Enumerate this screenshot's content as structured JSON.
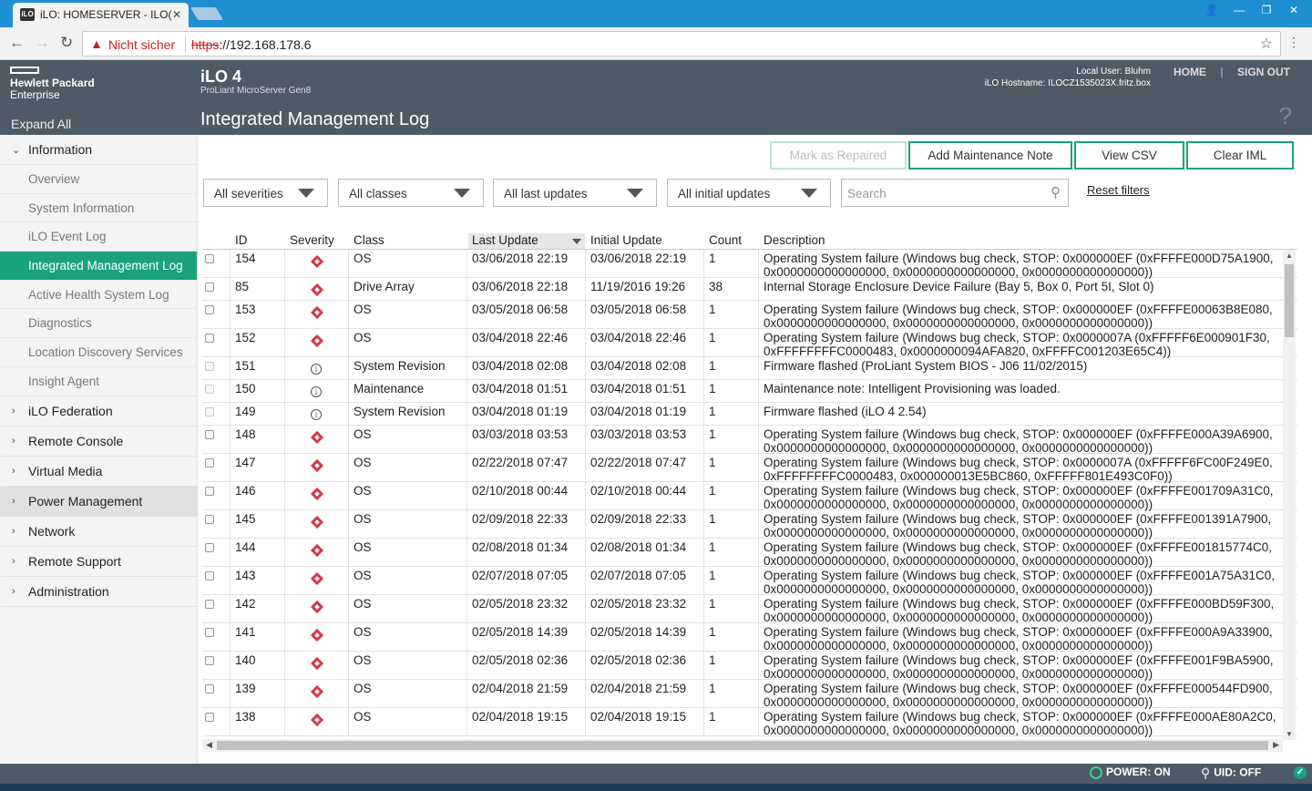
{
  "browser": {
    "tab_title": "iLO: HOMESERVER - ILO(",
    "tab_favicon": "iLO",
    "security_label": "Nicht sicher",
    "url_scheme": "https",
    "url_rest": "://192.168.178.6"
  },
  "header": {
    "brand_line1": "Hewlett Packard",
    "brand_line2": "Enterprise",
    "product": "iLO 4",
    "server_model": "ProLiant MicroServer Gen8",
    "page_title": "Integrated Management Log",
    "local_user": "Local User: Bluhm",
    "hostname": "iLO Hostname: ILOCZ1535023X.fritz.box",
    "home_link": "HOME",
    "sign_out_link": "SIGN OUT",
    "help_glyph": "?"
  },
  "sidebar": {
    "expand_all": "Expand All",
    "information_label": "Information",
    "info_items": [
      {
        "label": "Overview"
      },
      {
        "label": "System Information"
      },
      {
        "label": "iLO Event Log"
      },
      {
        "label": "Integrated Management Log"
      },
      {
        "label": "Active Health System Log"
      },
      {
        "label": "Diagnostics"
      },
      {
        "label": "Location Discovery Services"
      },
      {
        "label": "Insight Agent"
      }
    ],
    "sections": [
      {
        "label": "iLO Federation"
      },
      {
        "label": "Remote Console"
      },
      {
        "label": "Virtual Media"
      },
      {
        "label": "Power Management"
      },
      {
        "label": "Network"
      },
      {
        "label": "Remote Support"
      },
      {
        "label": "Administration"
      }
    ]
  },
  "actions": {
    "mark_repaired": "Mark as Repaired",
    "add_note": "Add Maintenance Note",
    "view_csv": "View CSV",
    "clear_iml": "Clear IML"
  },
  "filters": {
    "severity": "All severities",
    "class": "All classes",
    "last_updates": "All last updates",
    "initial_updates": "All initial updates",
    "search_placeholder": "Search",
    "reset": "Reset filters"
  },
  "table": {
    "columns": [
      "ID",
      "Severity",
      "Class",
      "Last Update",
      "Initial Update",
      "Count",
      "Description"
    ],
    "rows": [
      {
        "id": "154",
        "severity": "critical",
        "class": "OS",
        "last": "03/06/2018 22:19",
        "initial": "03/06/2018 22:19",
        "count": "1",
        "desc1": "Operating System failure (Windows bug check, STOP: 0x000000EF (0xFFFFE000D75A1900,",
        "desc2": "0x0000000000000000, 0x0000000000000000, 0x0000000000000000))"
      },
      {
        "id": "85",
        "severity": "critical",
        "class": "Drive Array",
        "last": "03/06/2018 22:18",
        "initial": "11/19/2016 19:26",
        "count": "38",
        "desc1": "Internal Storage Enclosure Device Failure (Bay 5, Box 0, Port 5I, Slot 0)",
        "desc2": ""
      },
      {
        "id": "153",
        "severity": "critical",
        "class": "OS",
        "last": "03/05/2018 06:58",
        "initial": "03/05/2018 06:58",
        "count": "1",
        "desc1": "Operating System failure (Windows bug check, STOP: 0x000000EF (0xFFFFE00063B8E080,",
        "desc2": "0x0000000000000000, 0x0000000000000000, 0x0000000000000000))"
      },
      {
        "id": "152",
        "severity": "critical",
        "class": "OS",
        "last": "03/04/2018 22:46",
        "initial": "03/04/2018 22:46",
        "count": "1",
        "desc1": "Operating System failure (Windows bug check, STOP: 0x0000007A (0xFFFFF6E000901F30,",
        "desc2": "0xFFFFFFFFC0000483, 0x0000000094AFA820, 0xFFFFC001203E65C4))"
      },
      {
        "id": "151",
        "severity": "info",
        "class": "System Revision",
        "last": "03/04/2018 02:08",
        "initial": "03/04/2018 02:08",
        "count": "1",
        "desc1": "Firmware flashed (ProLiant System BIOS - J06 11/02/2015)",
        "desc2": ""
      },
      {
        "id": "150",
        "severity": "info",
        "class": "Maintenance",
        "last": "03/04/2018 01:51",
        "initial": "03/04/2018 01:51",
        "count": "1",
        "desc1": "Maintenance note: Intelligent Provisioning was loaded.",
        "desc2": ""
      },
      {
        "id": "149",
        "severity": "info",
        "class": "System Revision",
        "last": "03/04/2018 01:19",
        "initial": "03/04/2018 01:19",
        "count": "1",
        "desc1": "Firmware flashed (iLO 4 2.54)",
        "desc2": ""
      },
      {
        "id": "148",
        "severity": "critical",
        "class": "OS",
        "last": "03/03/2018 03:53",
        "initial": "03/03/2018 03:53",
        "count": "1",
        "desc1": "Operating System failure (Windows bug check, STOP: 0x000000EF (0xFFFFE000A39A6900,",
        "desc2": "0x0000000000000000, 0x0000000000000000, 0x0000000000000000))"
      },
      {
        "id": "147",
        "severity": "critical",
        "class": "OS",
        "last": "02/22/2018 07:47",
        "initial": "02/22/2018 07:47",
        "count": "1",
        "desc1": "Operating System failure (Windows bug check, STOP: 0x0000007A (0xFFFFF6FC00F249E0,",
        "desc2": "0xFFFFFFFFC0000483, 0x000000013E5BC860, 0xFFFFF801E493C0F0))"
      },
      {
        "id": "146",
        "severity": "critical",
        "class": "OS",
        "last": "02/10/2018 00:44",
        "initial": "02/10/2018 00:44",
        "count": "1",
        "desc1": "Operating System failure (Windows bug check, STOP: 0x000000EF (0xFFFFE001709A31C0,",
        "desc2": "0x0000000000000000, 0x0000000000000000, 0x0000000000000000))"
      },
      {
        "id": "145",
        "severity": "critical",
        "class": "OS",
        "last": "02/09/2018 22:33",
        "initial": "02/09/2018 22:33",
        "count": "1",
        "desc1": "Operating System failure (Windows bug check, STOP: 0x000000EF (0xFFFFE001391A7900,",
        "desc2": "0x0000000000000000, 0x0000000000000000, 0x0000000000000000))"
      },
      {
        "id": "144",
        "severity": "critical",
        "class": "OS",
        "last": "02/08/2018 01:34",
        "initial": "02/08/2018 01:34",
        "count": "1",
        "desc1": "Operating System failure (Windows bug check, STOP: 0x000000EF (0xFFFFE001815774C0,",
        "desc2": "0x0000000000000000, 0x0000000000000000, 0x0000000000000000))"
      },
      {
        "id": "143",
        "severity": "critical",
        "class": "OS",
        "last": "02/07/2018 07:05",
        "initial": "02/07/2018 07:05",
        "count": "1",
        "desc1": "Operating System failure (Windows bug check, STOP: 0x000000EF (0xFFFFE001A75A31C0,",
        "desc2": "0x0000000000000000, 0x0000000000000000, 0x0000000000000000))"
      },
      {
        "id": "142",
        "severity": "critical",
        "class": "OS",
        "last": "02/05/2018 23:32",
        "initial": "02/05/2018 23:32",
        "count": "1",
        "desc1": "Operating System failure (Windows bug check, STOP: 0x000000EF (0xFFFFE000BD59F300,",
        "desc2": "0x0000000000000000, 0x0000000000000000, 0x0000000000000000))"
      },
      {
        "id": "141",
        "severity": "critical",
        "class": "OS",
        "last": "02/05/2018 14:39",
        "initial": "02/05/2018 14:39",
        "count": "1",
        "desc1": "Operating System failure (Windows bug check, STOP: 0x000000EF (0xFFFFE000A9A33900,",
        "desc2": "0x0000000000000000, 0x0000000000000000, 0x0000000000000000))"
      },
      {
        "id": "140",
        "severity": "critical",
        "class": "OS",
        "last": "02/05/2018 02:36",
        "initial": "02/05/2018 02:36",
        "count": "1",
        "desc1": "Operating System failure (Windows bug check, STOP: 0x000000EF (0xFFFFE001F9BA5900,",
        "desc2": "0x0000000000000000, 0x0000000000000000, 0x0000000000000000))"
      },
      {
        "id": "139",
        "severity": "critical",
        "class": "OS",
        "last": "02/04/2018 21:59",
        "initial": "02/04/2018 21:59",
        "count": "1",
        "desc1": "Operating System failure (Windows bug check, STOP: 0x000000EF (0xFFFFE000544FD900,",
        "desc2": "0x0000000000000000, 0x0000000000000000, 0x0000000000000000))"
      },
      {
        "id": "138",
        "severity": "critical",
        "class": "OS",
        "last": "02/04/2018 19:15",
        "initial": "02/04/2018 19:15",
        "count": "1",
        "desc1": "Operating System failure (Windows bug check, STOP: 0x000000EF (0xFFFFE000AE80A2C0,",
        "desc2": "0x0000000000000000, 0x0000000000000000, 0x0000000000000000))"
      }
    ]
  },
  "footer": {
    "power": "POWER: ON",
    "uid": "UID: OFF"
  },
  "colors": {
    "accent": "#1aa27e",
    "header_bg": "#4d5b66",
    "critical": "#d33a4a"
  }
}
